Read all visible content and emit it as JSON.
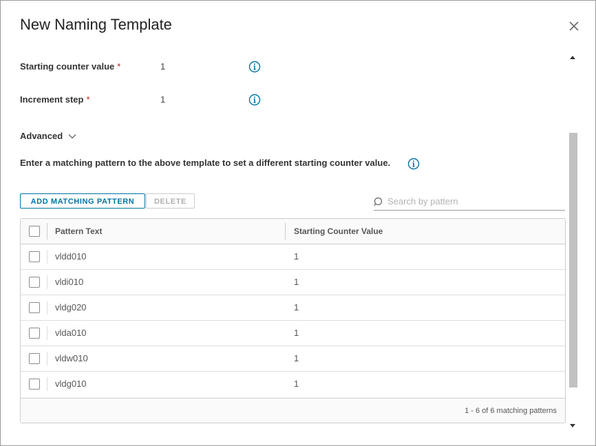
{
  "dialog": {
    "title": "New Naming Template"
  },
  "fields": {
    "starting_counter": {
      "label": "Starting counter value",
      "required_mark": "*",
      "value": "1"
    },
    "increment_step": {
      "label": "Increment step",
      "required_mark": "*",
      "value": "1"
    }
  },
  "advanced": {
    "label": "Advanced",
    "expanded": true
  },
  "hint": {
    "text": "Enter a matching pattern to the above template to set a different starting counter value."
  },
  "toolbar": {
    "add_label": "ADD MATCHING PATTERN",
    "delete_label": "DELETE",
    "delete_disabled": true
  },
  "search": {
    "placeholder": "Search by pattern",
    "value": ""
  },
  "grid": {
    "columns": [
      "Pattern Text",
      "Starting Counter Value"
    ],
    "rows": [
      {
        "pattern": "vldd010",
        "counter": "1"
      },
      {
        "pattern": "vldi010",
        "counter": "1"
      },
      {
        "pattern": "vldg020",
        "counter": "1"
      },
      {
        "pattern": "vlda010",
        "counter": "1"
      },
      {
        "pattern": "vldw010",
        "counter": "1"
      },
      {
        "pattern": "vldg010",
        "counter": "1"
      }
    ],
    "footer": "1 - 6 of 6 matching patterns"
  },
  "colors": {
    "primary": "#0072a3",
    "required": "#c92100",
    "border": "#cccccc"
  },
  "icons": {
    "close": "close-icon",
    "info": "info-icon",
    "chevron": "chevron-down-icon",
    "search": "search-icon"
  }
}
